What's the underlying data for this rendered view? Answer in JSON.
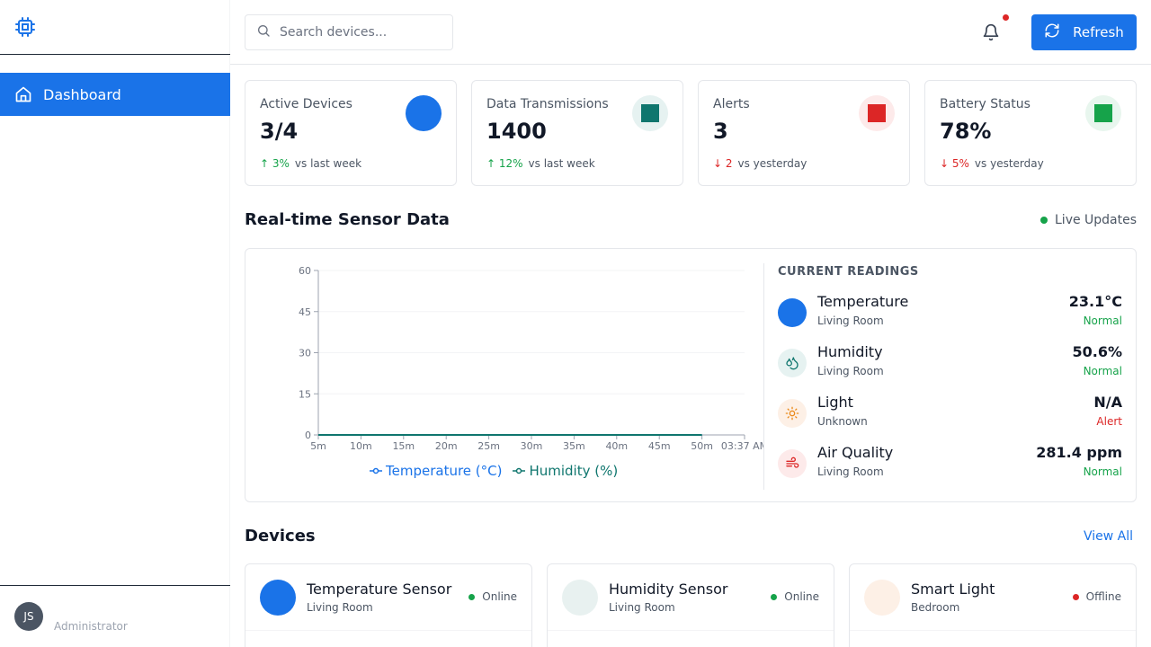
{
  "sidebar": {
    "logo_icon": "chip-icon",
    "nav": [
      {
        "label": "Dashboard",
        "icon": "home-icon",
        "active": true
      }
    ],
    "user": {
      "initials": "JS",
      "role": "Administrator"
    }
  },
  "header": {
    "search_placeholder": "Search devices...",
    "notifications_icon": "bell-icon",
    "has_notification": true,
    "refresh_label": "Refresh"
  },
  "stats": [
    {
      "label": "Active Devices",
      "value": "3/4",
      "trend_dir": "up",
      "trend_value": "3%",
      "trend_text": "vs last week",
      "color": "#1a73e8"
    },
    {
      "label": "Data Transmissions",
      "value": "1400",
      "trend_dir": "up",
      "trend_value": "12%",
      "trend_text": "vs last week",
      "color": "#0f766e"
    },
    {
      "label": "Alerts",
      "value": "3",
      "trend_dir": "down",
      "trend_value": "2",
      "trend_text": "vs yesterday",
      "color": "#dc2626"
    },
    {
      "label": "Battery Status",
      "value": "78%",
      "trend_dir": "down",
      "trend_value": "5%",
      "trend_text": "vs yesterday",
      "color": "#16a34a"
    }
  ],
  "sensor_section": {
    "title": "Real-time Sensor Data",
    "live_label": "Live Updates"
  },
  "chart_data": {
    "type": "line",
    "x": [
      "5m",
      "10m",
      "15m",
      "20m",
      "25m",
      "30m",
      "35m",
      "40m",
      "45m",
      "50m",
      "03:37 AM"
    ],
    "ylim": [
      0,
      60
    ],
    "yticks": [
      0,
      15,
      30,
      45,
      60
    ],
    "series": [
      {
        "name": "Temperature (°C)",
        "color": "#1a73e8",
        "values": [
          0,
          0,
          0,
          0,
          0,
          0,
          0,
          0,
          0,
          0,
          0
        ]
      },
      {
        "name": "Humidity (%)",
        "color": "#0f766e",
        "values": [
          0,
          0,
          0,
          0,
          0,
          0,
          0,
          0,
          0,
          0,
          0
        ]
      }
    ],
    "legend": "bottom"
  },
  "current_readings": {
    "title": "CURRENT READINGS",
    "items": [
      {
        "name": "Temperature",
        "location": "Living Room",
        "value": "23.1°C",
        "status": "Normal",
        "status_color": "#16a34a",
        "icon": "thermometer-icon",
        "icon_bg": "#1a73e8"
      },
      {
        "name": "Humidity",
        "location": "Living Room",
        "value": "50.6%",
        "status": "Normal",
        "status_color": "#16a34a",
        "icon": "droplets-icon",
        "icon_bg": "#e6f2f1"
      },
      {
        "name": "Light",
        "location": "Unknown",
        "value": "N/A",
        "status": "Alert",
        "status_color": "#dc2626",
        "icon": "sun-icon",
        "icon_bg": "#fdf0e6"
      },
      {
        "name": "Air Quality",
        "location": "Living Room",
        "value": "281.4 ppm",
        "status": "Normal",
        "status_color": "#16a34a",
        "icon": "wind-icon",
        "icon_bg": "#fdeaea"
      }
    ]
  },
  "devices_section": {
    "title": "Devices",
    "view_all_label": "View All"
  },
  "devices": [
    {
      "name": "Temperature Sensor",
      "location": "Living Room",
      "status": "Online",
      "status_color": "#16a34a",
      "icon_bg": "#1a73e8"
    },
    {
      "name": "Humidity Sensor",
      "location": "Living Room",
      "status": "Online",
      "status_color": "#16a34a",
      "icon_bg": "#e8f1f0"
    },
    {
      "name": "Smart Light",
      "location": "Bedroom",
      "status": "Offline",
      "status_color": "#dc2626",
      "icon_bg": "#fdf0e6"
    }
  ]
}
